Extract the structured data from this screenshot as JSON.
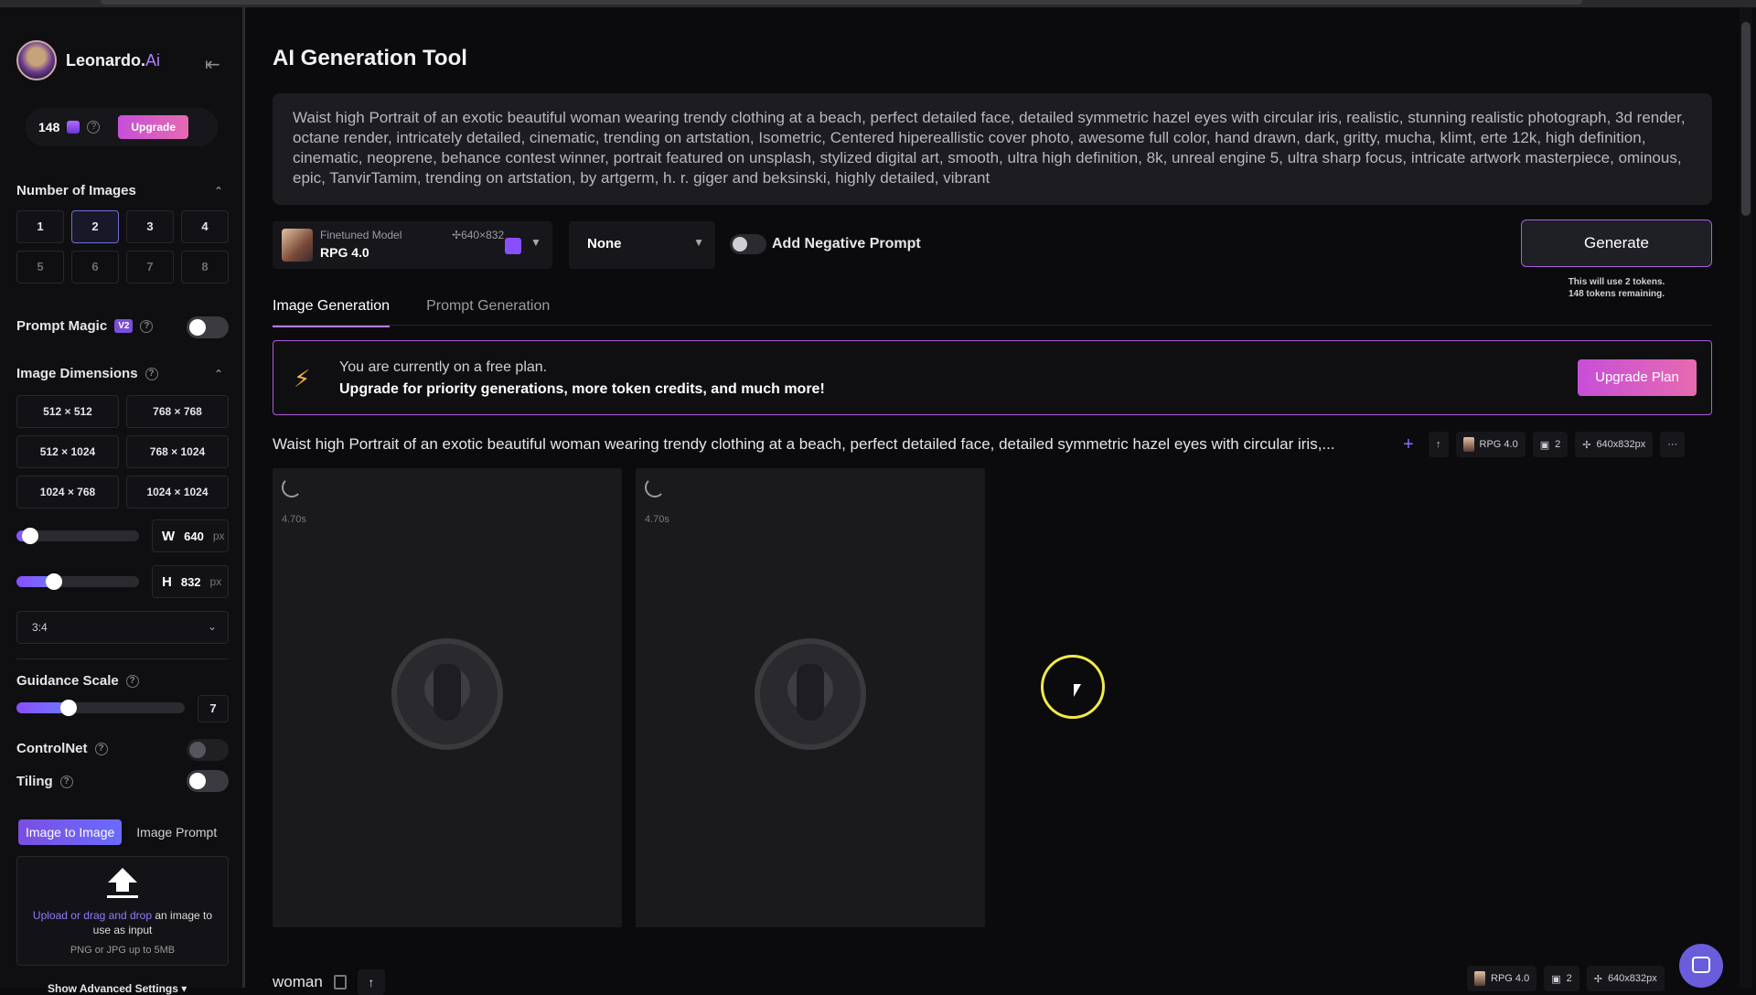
{
  "app": {
    "name": "Leonardo.",
    "name_accent": "Ai"
  },
  "sidebar": {
    "tokens": "148",
    "upgrade_label": "Upgrade",
    "num_images_title": "Number of Images",
    "num_images": [
      "1",
      "2",
      "3",
      "4",
      "5",
      "6",
      "7",
      "8"
    ],
    "num_images_selected": "2",
    "prompt_magic_label": "Prompt Magic",
    "prompt_magic_badge": "V2",
    "image_dimensions_title": "Image Dimensions",
    "dimensions": [
      "512 × 512",
      "768 × 768",
      "512 × 1024",
      "768 × 1024",
      "1024 × 768",
      "1024 × 1024"
    ],
    "width_letter": "W",
    "width_value": "640",
    "height_letter": "H",
    "height_value": "832",
    "unit": "px",
    "aspect_ratio": "3:4",
    "guidance_scale_label": "Guidance Scale",
    "guidance_scale_value": "7",
    "controlnet_label": "ControlNet",
    "tiling_label": "Tiling",
    "image_to_image_tab": "Image to Image",
    "image_prompt_tab": "Image Prompt",
    "upload_link": "Upload or drag and drop",
    "upload_rest": " an image to use as input",
    "upload_sub": "PNG or JPG up to 5MB",
    "advanced_settings": "Show Advanced Settings"
  },
  "main": {
    "title": "AI Generation Tool",
    "prompt": "Waist high Portrait of an exotic beautiful woman wearing trendy clothing at a beach,  perfect detailed face, detailed symmetric hazel eyes with circular iris, realistic, stunning realistic photograph, 3d render, octane render, intricately detailed, cinematic, trending on artstation, Isometric, Centered hipereallistic cover photo, awesome full color, hand drawn, dark, gritty, mucha, klimt, erte 12k, high definition, cinematic, neoprene, behance contest winner, portrait featured on unsplash, stylized digital art, smooth, ultra high definition, 8k, unreal engine 5, ultra sharp focus, intricate artwork masterpiece, ominous, epic, TanvirTamim, trending on artstation, by artgerm, h. r. giger and beksinski, highly detailed, vibrant",
    "model_label": "Finetuned Model",
    "model_size": "640×832",
    "model_name": "RPG 4.0",
    "style": "None",
    "negative_prompt_label": "Add Negative Prompt",
    "generate_label": "Generate",
    "generate_note_1": "This will use 2 tokens.",
    "generate_note_2": "148 tokens remaining.",
    "tabs": [
      "Image Generation",
      "Prompt Generation"
    ],
    "banner_line1": "You are currently on a free plan.",
    "banner_line2": "Upgrade for priority generations, more token credits, and much more!",
    "upgrade_plan_label": "Upgrade Plan",
    "result_prompt": "Waist high Portrait of an exotic beautiful woman wearing trendy clothing at a beach, perfect detailed face, detailed symmetric hazel eyes with circular iris,...",
    "meta_model": "RPG 4.0",
    "meta_count": "2",
    "meta_size": "640x832px",
    "card_time_1": "4.70s",
    "card_time_2": "4.70s",
    "bottom_word": "woman",
    "bottom_meta_model": "RPG 4.0",
    "bottom_meta_count": "2",
    "bottom_meta_size": "640x832px"
  }
}
